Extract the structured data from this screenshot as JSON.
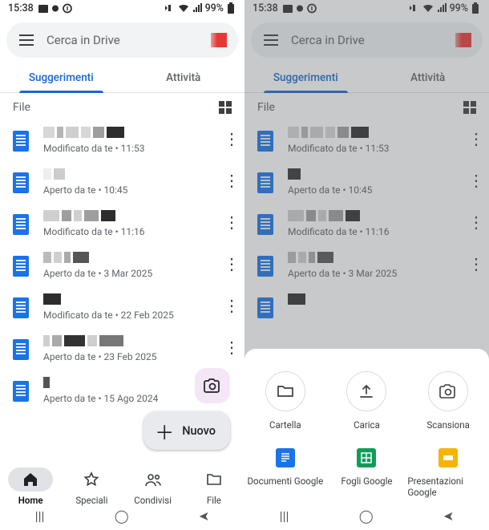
{
  "status": {
    "time": "15:38",
    "battery": "99%"
  },
  "search": {
    "placeholder": "Cerca in Drive"
  },
  "tabs": {
    "a": "Suggerimenti",
    "b": "Attività"
  },
  "section": "File",
  "files": [
    {
      "sub": "Modificato da te • 11:53"
    },
    {
      "sub": "Aperto da te • 10:45"
    },
    {
      "sub": "Modificato da te • 11:16"
    },
    {
      "sub": "Aperto da te • 3 Mar 2025"
    },
    {
      "sub": "Modificato da te • 22 Feb 2025"
    },
    {
      "sub": "Aperto da te • 23 Feb 2025"
    },
    {
      "sub": "Aperto da te • 15 Ago 2024"
    }
  ],
  "fab": "Nuovo",
  "bottomNav": {
    "home": "Home",
    "starred": "Speciali",
    "shared": "Condivisi",
    "files": "File"
  },
  "sheet": {
    "folder": "Cartella",
    "upload": "Carica",
    "scan": "Scansiona",
    "docs": "Documenti Google",
    "sheets": "Fogli Google",
    "slides": "Presentazioni Google"
  }
}
